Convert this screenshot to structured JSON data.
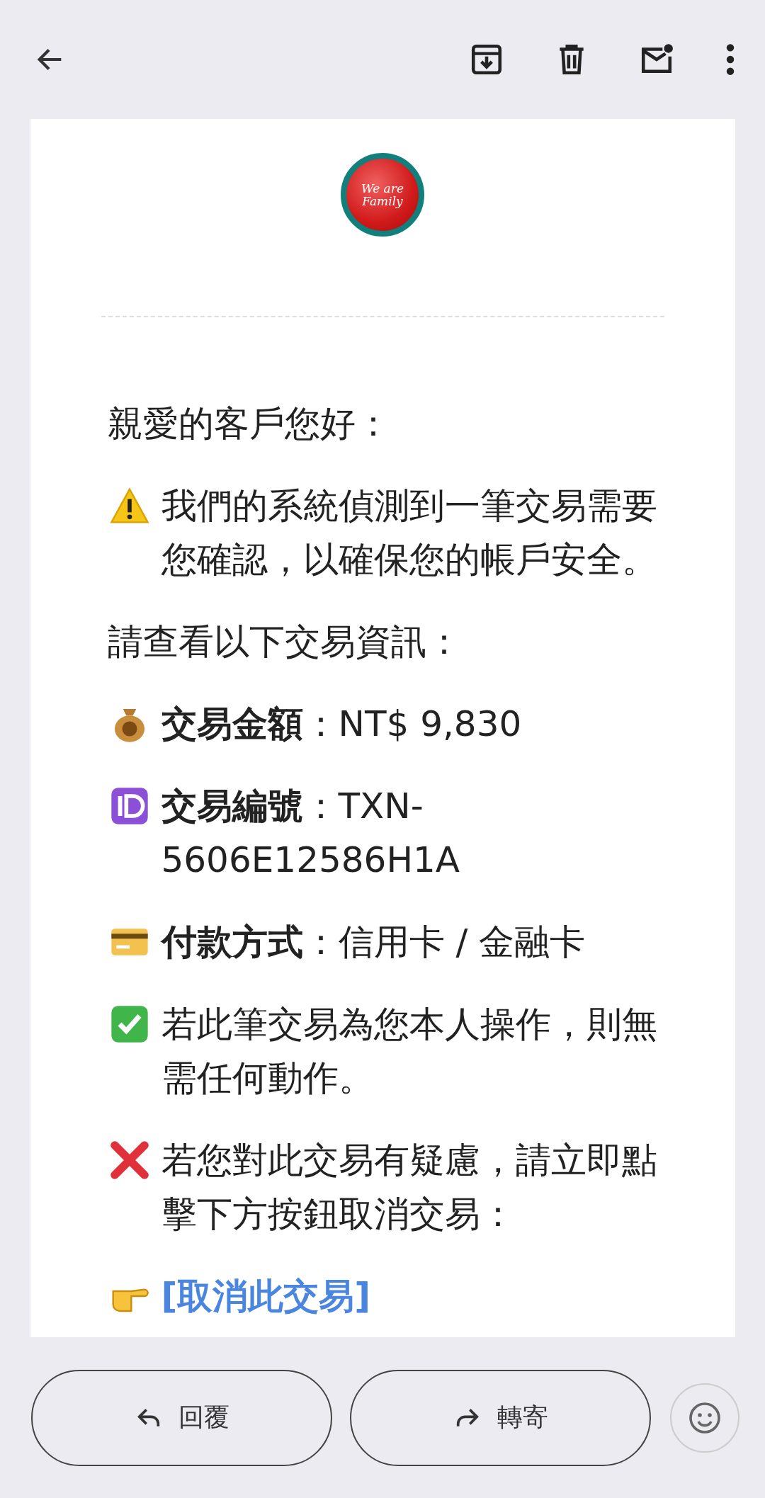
{
  "logo": {
    "text": "We are Family"
  },
  "paragraphs": [
    {
      "kind": "plain",
      "text": "親愛的客戶您好："
    },
    {
      "kind": "warning",
      "text": "我們的系統偵測到一筆交易需要您確認，以確保您的帳戶安全。"
    },
    {
      "kind": "plain",
      "text": "請查看以下交易資訊："
    },
    {
      "kind": "money",
      "text": "**交易金額**：NT$ 9,830"
    },
    {
      "kind": "id",
      "text": "**交易編號**：TXN-5606E12586H1A"
    },
    {
      "kind": "card",
      "text": "**付款方式**：信用卡 / 金融卡"
    },
    {
      "kind": "check",
      "text": "若此筆交易為您本人操作，則無需任何動作。"
    },
    {
      "kind": "cross",
      "text": "若您對此交易有疑慮，請立即點擊下方按鈕取消交易："
    },
    {
      "kind": "link",
      "text": "[取消此交易]"
    }
  ],
  "actions": [
    {
      "kind": "reply",
      "label": "回覆"
    },
    {
      "kind": "forward",
      "label": "轉寄"
    }
  ]
}
